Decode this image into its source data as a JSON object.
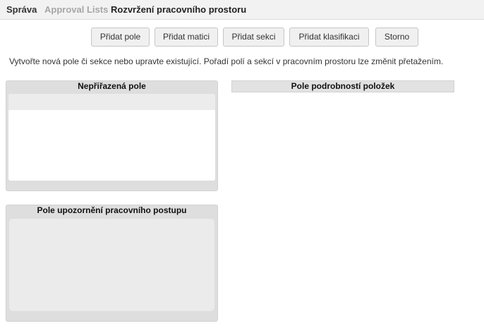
{
  "breadcrumb": {
    "items": [
      {
        "label": "Správa"
      },
      {
        "label": "Approval Lists"
      },
      {
        "label": "Rozvržení pracovního prostoru"
      }
    ]
  },
  "toolbar": {
    "add_field_label": "Přidat pole",
    "add_matrix_label": "Přidat matici",
    "add_section_label": "Přidat sekci",
    "add_classification_label": "Přidat klasifikaci",
    "cancel_label": "Storno"
  },
  "instruction_text": "Vytvořte nová pole či sekce nebo upravte existující. Pořadí polí a sekcí v pracovním prostoru lze změnit přetažením.",
  "panels": {
    "unassigned_title": "Nepřiřazená pole",
    "workflow_notification_title": "Pole upozornění pracovního postupu",
    "item_details_title": "Pole podrobností položek"
  },
  "colors": {
    "breadcrumb_bar": "#f2f2f2",
    "button_bg": "#f0f0f0",
    "panel_bg": "#dedede",
    "inactive_crumb": "#a6a6a6"
  }
}
